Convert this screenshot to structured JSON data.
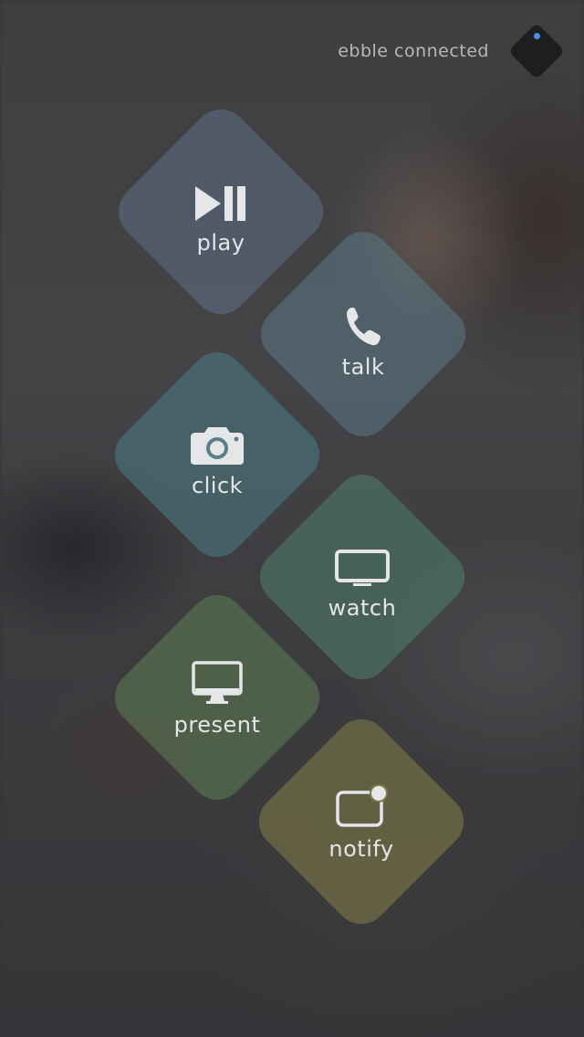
{
  "status": {
    "text": "ebble connected"
  },
  "tiles": [
    {
      "id": "play",
      "label": "play",
      "icon": "play-pause-icon",
      "color": "#5d6f86"
    },
    {
      "id": "talk",
      "label": "talk",
      "icon": "phone-icon",
      "color": "#587586"
    },
    {
      "id": "click",
      "label": "click",
      "icon": "camera-icon",
      "color": "#4c7882"
    },
    {
      "id": "watch",
      "label": "watch",
      "icon": "tv-icon",
      "color": "#4f7a68"
    },
    {
      "id": "present",
      "label": "present",
      "icon": "monitor-icon",
      "color": "#5d7a4f"
    },
    {
      "id": "notify",
      "label": "notify",
      "icon": "notification-icon",
      "color": "#7a7a48"
    }
  ],
  "colors": {
    "indicator_dot": "#4a90e2",
    "tile_text": "#e4e6e8",
    "status_text": "#b7b7bb"
  }
}
